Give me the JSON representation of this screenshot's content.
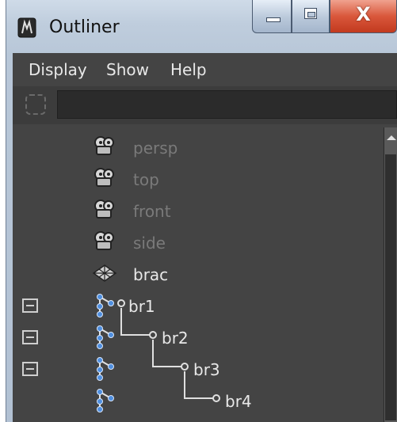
{
  "window": {
    "title": "Outliner"
  },
  "titlebar": {
    "close_glyph": "X"
  },
  "menubar": {
    "items": [
      "Display",
      "Show",
      "Help"
    ]
  },
  "filter": {
    "value": ""
  },
  "outliner": {
    "items": [
      {
        "label": "persp",
        "icon": "camera-icon",
        "dimmed": true
      },
      {
        "label": "top",
        "icon": "camera-icon",
        "dimmed": true
      },
      {
        "label": "front",
        "icon": "camera-icon",
        "dimmed": true
      },
      {
        "label": "side",
        "icon": "camera-icon",
        "dimmed": true
      },
      {
        "label": "brac",
        "icon": "mesh-icon",
        "dimmed": false
      },
      {
        "label": "br1",
        "icon": "joint-icon",
        "dimmed": false,
        "expanded": true
      },
      {
        "label": "br2",
        "icon": "joint-icon",
        "dimmed": false,
        "expanded": true
      },
      {
        "label": "br3",
        "icon": "joint-icon",
        "dimmed": false,
        "expanded": true
      },
      {
        "label": "br4",
        "icon": "joint-icon",
        "dimmed": false
      }
    ]
  },
  "colors": {
    "panel_bg": "#444444",
    "text": "#e8e8e8",
    "dim_text": "#7a7a7a",
    "joint_blue": "#4f8fe0"
  }
}
